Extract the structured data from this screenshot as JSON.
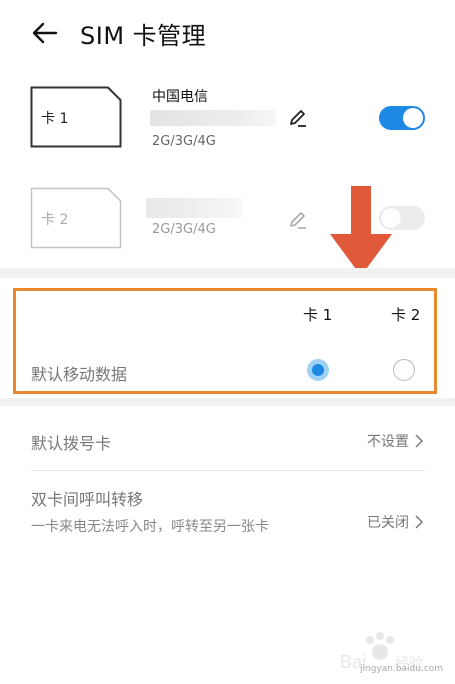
{
  "header": {
    "title": "SIM 卡管理"
  },
  "sims": [
    {
      "card_label": "卡 1",
      "carrier": "中国电信",
      "network_types": "2G/3G/4G",
      "enabled": true
    },
    {
      "card_label": "卡 2",
      "carrier": "",
      "network_types": "2G/3G/4G",
      "enabled": false
    }
  ],
  "default_data": {
    "label": "默认移动数据",
    "columns": [
      "卡 1",
      "卡 2"
    ],
    "selected_index": 0
  },
  "list": {
    "default_dial": {
      "label": "默认拨号卡",
      "value": "不设置"
    },
    "call_forward": {
      "label": "双卡间呼叫转移",
      "desc": "一卡来电无法呼入时，呼转至另一张卡",
      "value": "已关闭"
    }
  },
  "watermark": {
    "text": "jingyan.baidu.com"
  },
  "colors": {
    "accent": "#1e88e5",
    "highlight_border": "#e8892f",
    "arrow": "#e05a3a"
  }
}
